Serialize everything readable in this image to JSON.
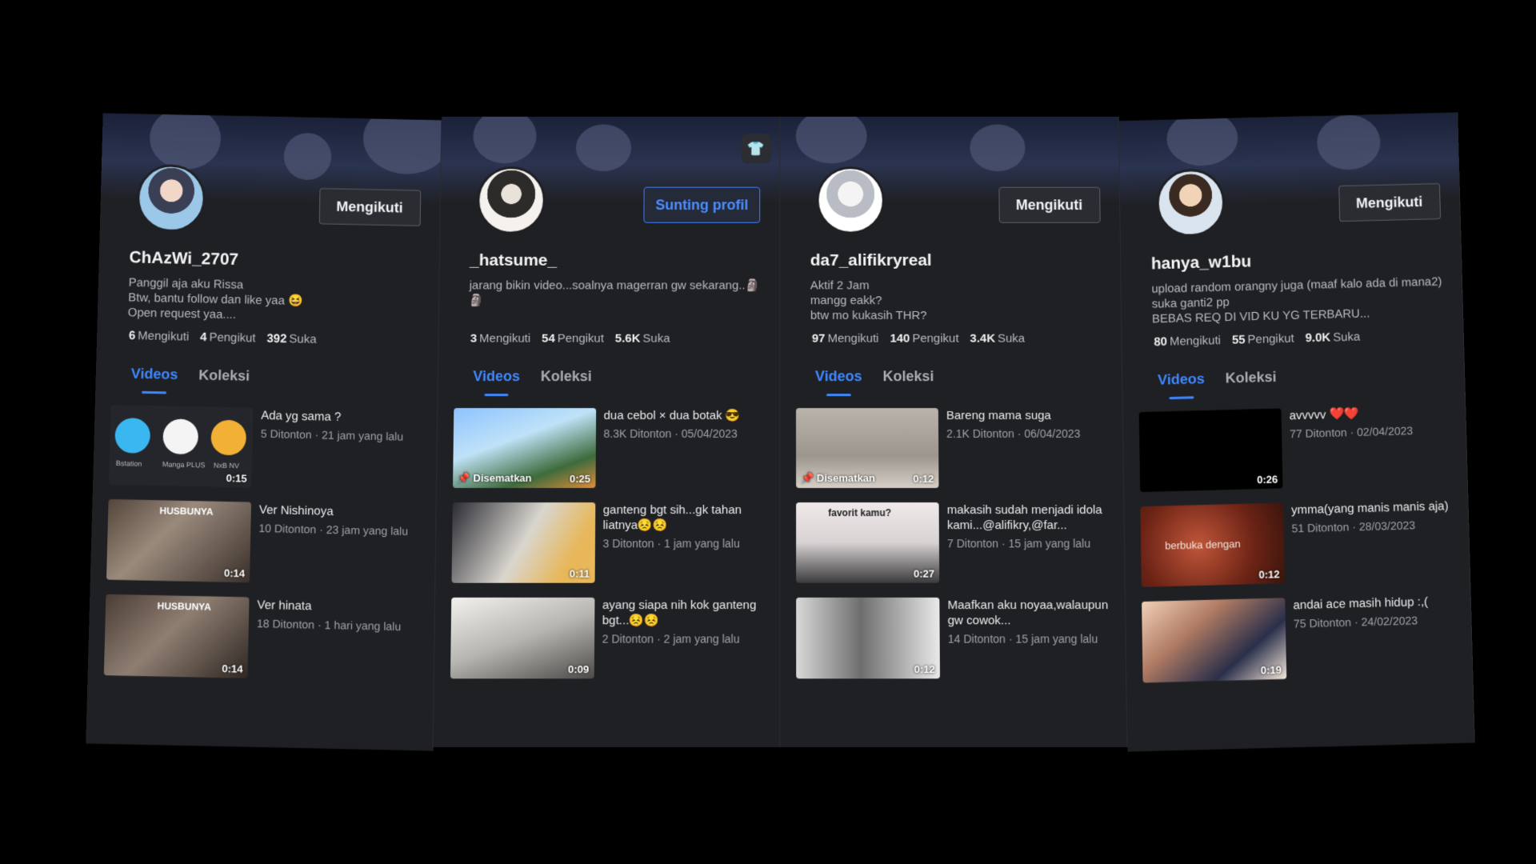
{
  "profiles": [
    {
      "action": "Mengikuti",
      "username": "ChAzWi_2707",
      "bio": "Panggil aja aku Rissa\nBtw, bantu follow dan like yaa 😆\nOpen request yaa....",
      "stats": {
        "following": "6",
        "following_label": "Mengikuti",
        "followers": "4",
        "followers_label": "Pengikut",
        "likes": "392",
        "likes_label": "Suka"
      },
      "tabs": [
        "Videos",
        "Koleksi"
      ],
      "videos": [
        {
          "title": "Ada yg sama ?",
          "meta": "5 Ditonton · 21 jam yang lalu",
          "duration": "0:15",
          "thumb_labels": [
            "Bstation",
            "Manga PLUS",
            "NxB NV"
          ]
        },
        {
          "title": "Ver Nishinoya",
          "meta": "10 Ditonton · 23 jam yang lalu",
          "duration": "0:14",
          "thumb_text": "HUSBUNYA"
        },
        {
          "title": "Ver hinata",
          "meta": "18 Ditonton · 1 hari yang lalu",
          "duration": "0:14",
          "thumb_text": "HUSBUNYA"
        }
      ]
    },
    {
      "action": "Sunting profil",
      "username": "_hatsume_",
      "bio": "jarang bikin video...soalnya magerran gw sekarang..🗿🗿",
      "stats": {
        "following": "3",
        "following_label": "Mengikuti",
        "followers": "54",
        "followers_label": "Pengikut",
        "likes": "5.6K",
        "likes_label": "Suka"
      },
      "tabs": [
        "Videos",
        "Koleksi"
      ],
      "videos": [
        {
          "title": "dua cebol × dua botak 😎",
          "meta": "8.3K Ditonton · 05/04/2023",
          "duration": "0:25",
          "pinned": "Disematkan"
        },
        {
          "title": "ganteng bgt sih...gk tahan liatnya😣😣",
          "meta": "3 Ditonton · 1 jam yang lalu",
          "duration": "0:11"
        },
        {
          "title": "ayang siapa nih kok ganteng bgt...😣😣",
          "meta": "2 Ditonton · 2 jam yang lalu",
          "duration": "0:09"
        }
      ]
    },
    {
      "action": "Mengikuti",
      "username": "da7_alifikryreal",
      "bio": "Aktif 2 Jam\nmangg eakk?\nbtw mo kukasih THR?",
      "stats": {
        "following": "97",
        "following_label": "Mengikuti",
        "followers": "140",
        "followers_label": "Pengikut",
        "likes": "3.4K",
        "likes_label": "Suka"
      },
      "tabs": [
        "Videos",
        "Koleksi"
      ],
      "videos": [
        {
          "title": "Bareng mama suga",
          "meta": "2.1K Ditonton · 06/04/2023",
          "duration": "0:12",
          "pinned": "Disematkan"
        },
        {
          "title": "makasih sudah menjadi idola kami...@alifikry,@far...",
          "meta": "7 Ditonton · 15 jam yang lalu",
          "duration": "0:27",
          "thumb_text": "favorit kamu?"
        },
        {
          "title": "Maafkan aku noyaa,walaupun gw cowok...",
          "meta": "14 Ditonton · 15 jam yang lalu",
          "duration": "0:12"
        }
      ]
    },
    {
      "action": "Mengikuti",
      "username": "hanya_w1bu",
      "bio": "upload random orangny juga (maaf kalo ada di mana2) suka ganti2 pp\nBEBAS REQ DI VID KU YG TERBARU...",
      "stats": {
        "following": "80",
        "following_label": "Mengikuti",
        "followers": "55",
        "followers_label": "Pengikut",
        "likes": "9.0K",
        "likes_label": "Suka"
      },
      "tabs": [
        "Videos",
        "Koleksi"
      ],
      "videos": [
        {
          "title": "avvvvv ❤️❤️",
          "meta": "77 Ditonton · 02/04/2023",
          "duration": "0:26"
        },
        {
          "title": "ymma(yang manis manis aja)",
          "meta": "51 Ditonton · 28/03/2023",
          "duration": "0:12",
          "thumb_text": "berbuka dengan"
        },
        {
          "title": "andai ace masih hidup :,(",
          "meta": "75 Ditonton · 24/02/2023",
          "duration": "0:19"
        }
      ]
    }
  ],
  "icons": {
    "wardrobe": "shirt-icon",
    "pin": "pin-icon"
  }
}
